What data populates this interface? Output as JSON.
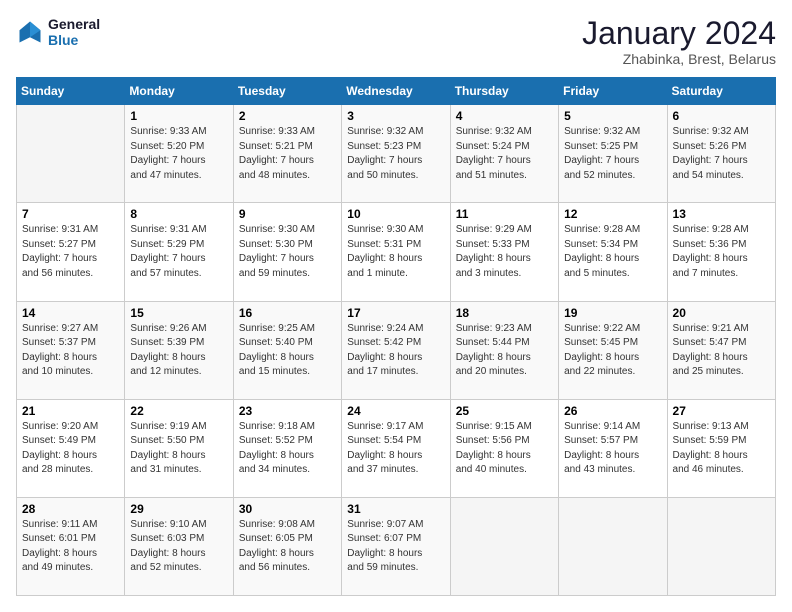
{
  "logo": {
    "line1": "General",
    "line2": "Blue"
  },
  "title": "January 2024",
  "subtitle": "Zhabinka, Brest, Belarus",
  "days_header": [
    "Sunday",
    "Monday",
    "Tuesday",
    "Wednesday",
    "Thursday",
    "Friday",
    "Saturday"
  ],
  "weeks": [
    [
      {
        "day": "",
        "info": ""
      },
      {
        "day": "1",
        "info": "Sunrise: 9:33 AM\nSunset: 5:20 PM\nDaylight: 7 hours\nand 47 minutes."
      },
      {
        "day": "2",
        "info": "Sunrise: 9:33 AM\nSunset: 5:21 PM\nDaylight: 7 hours\nand 48 minutes."
      },
      {
        "day": "3",
        "info": "Sunrise: 9:32 AM\nSunset: 5:23 PM\nDaylight: 7 hours\nand 50 minutes."
      },
      {
        "day": "4",
        "info": "Sunrise: 9:32 AM\nSunset: 5:24 PM\nDaylight: 7 hours\nand 51 minutes."
      },
      {
        "day": "5",
        "info": "Sunrise: 9:32 AM\nSunset: 5:25 PM\nDaylight: 7 hours\nand 52 minutes."
      },
      {
        "day": "6",
        "info": "Sunrise: 9:32 AM\nSunset: 5:26 PM\nDaylight: 7 hours\nand 54 minutes."
      }
    ],
    [
      {
        "day": "7",
        "info": "Sunrise: 9:31 AM\nSunset: 5:27 PM\nDaylight: 7 hours\nand 56 minutes."
      },
      {
        "day": "8",
        "info": "Sunrise: 9:31 AM\nSunset: 5:29 PM\nDaylight: 7 hours\nand 57 minutes."
      },
      {
        "day": "9",
        "info": "Sunrise: 9:30 AM\nSunset: 5:30 PM\nDaylight: 7 hours\nand 59 minutes."
      },
      {
        "day": "10",
        "info": "Sunrise: 9:30 AM\nSunset: 5:31 PM\nDaylight: 8 hours\nand 1 minute."
      },
      {
        "day": "11",
        "info": "Sunrise: 9:29 AM\nSunset: 5:33 PM\nDaylight: 8 hours\nand 3 minutes."
      },
      {
        "day": "12",
        "info": "Sunrise: 9:28 AM\nSunset: 5:34 PM\nDaylight: 8 hours\nand 5 minutes."
      },
      {
        "day": "13",
        "info": "Sunrise: 9:28 AM\nSunset: 5:36 PM\nDaylight: 8 hours\nand 7 minutes."
      }
    ],
    [
      {
        "day": "14",
        "info": "Sunrise: 9:27 AM\nSunset: 5:37 PM\nDaylight: 8 hours\nand 10 minutes."
      },
      {
        "day": "15",
        "info": "Sunrise: 9:26 AM\nSunset: 5:39 PM\nDaylight: 8 hours\nand 12 minutes."
      },
      {
        "day": "16",
        "info": "Sunrise: 9:25 AM\nSunset: 5:40 PM\nDaylight: 8 hours\nand 15 minutes."
      },
      {
        "day": "17",
        "info": "Sunrise: 9:24 AM\nSunset: 5:42 PM\nDaylight: 8 hours\nand 17 minutes."
      },
      {
        "day": "18",
        "info": "Sunrise: 9:23 AM\nSunset: 5:44 PM\nDaylight: 8 hours\nand 20 minutes."
      },
      {
        "day": "19",
        "info": "Sunrise: 9:22 AM\nSunset: 5:45 PM\nDaylight: 8 hours\nand 22 minutes."
      },
      {
        "day": "20",
        "info": "Sunrise: 9:21 AM\nSunset: 5:47 PM\nDaylight: 8 hours\nand 25 minutes."
      }
    ],
    [
      {
        "day": "21",
        "info": "Sunrise: 9:20 AM\nSunset: 5:49 PM\nDaylight: 8 hours\nand 28 minutes."
      },
      {
        "day": "22",
        "info": "Sunrise: 9:19 AM\nSunset: 5:50 PM\nDaylight: 8 hours\nand 31 minutes."
      },
      {
        "day": "23",
        "info": "Sunrise: 9:18 AM\nSunset: 5:52 PM\nDaylight: 8 hours\nand 34 minutes."
      },
      {
        "day": "24",
        "info": "Sunrise: 9:17 AM\nSunset: 5:54 PM\nDaylight: 8 hours\nand 37 minutes."
      },
      {
        "day": "25",
        "info": "Sunrise: 9:15 AM\nSunset: 5:56 PM\nDaylight: 8 hours\nand 40 minutes."
      },
      {
        "day": "26",
        "info": "Sunrise: 9:14 AM\nSunset: 5:57 PM\nDaylight: 8 hours\nand 43 minutes."
      },
      {
        "day": "27",
        "info": "Sunrise: 9:13 AM\nSunset: 5:59 PM\nDaylight: 8 hours\nand 46 minutes."
      }
    ],
    [
      {
        "day": "28",
        "info": "Sunrise: 9:11 AM\nSunset: 6:01 PM\nDaylight: 8 hours\nand 49 minutes."
      },
      {
        "day": "29",
        "info": "Sunrise: 9:10 AM\nSunset: 6:03 PM\nDaylight: 8 hours\nand 52 minutes."
      },
      {
        "day": "30",
        "info": "Sunrise: 9:08 AM\nSunset: 6:05 PM\nDaylight: 8 hours\nand 56 minutes."
      },
      {
        "day": "31",
        "info": "Sunrise: 9:07 AM\nSunset: 6:07 PM\nDaylight: 8 hours\nand 59 minutes."
      },
      {
        "day": "",
        "info": ""
      },
      {
        "day": "",
        "info": ""
      },
      {
        "day": "",
        "info": ""
      }
    ]
  ]
}
